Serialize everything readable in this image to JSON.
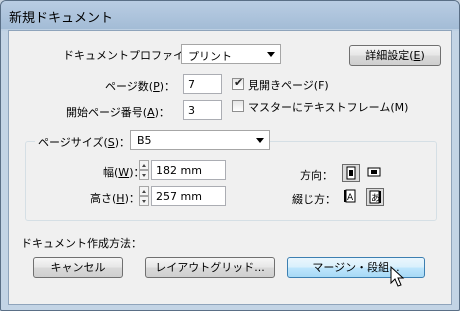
{
  "window": {
    "title": "新規ドキュメント"
  },
  "profile": {
    "label": "ドキュメントプロファイル：",
    "value": "プリント"
  },
  "detail_button": {
    "label_main": "詳細設定(",
    "label_key": "E",
    "label_end": ")"
  },
  "pages": {
    "label_main": "ページ数(",
    "label_key": "P",
    "label_end": ")：",
    "value": "7"
  },
  "start_page": {
    "label_main": "開始ページ番号(",
    "label_key": "A",
    "label_end": ")：",
    "value": "3"
  },
  "facing_pages": {
    "label": "見開きページ(F)",
    "checked": true
  },
  "master_text_frame": {
    "label": "マスターにテキストフレーム(M)",
    "checked": false
  },
  "page_size": {
    "label_main": "ページサイズ(",
    "label_key": "S",
    "label_end": ")：",
    "value": "B5",
    "width_label_main": "幅(",
    "width_label_key": "W",
    "width_label_end": ")：",
    "width_value": "182 mm",
    "height_label_main": "高さ(",
    "height_label_key": "H",
    "height_label_end": ")：",
    "height_value": "257 mm",
    "orientation_label": "方向：",
    "binding_label": "綴じ方：",
    "orientation_selected": "portrait",
    "binding_selected": "right-to-left"
  },
  "creation_method": {
    "label": "ドキュメント作成方法："
  },
  "buttons": {
    "cancel": "キャンセル",
    "layout_grid": "レイアウトグリッド...",
    "margin_columns": "マージン・段組..."
  }
}
